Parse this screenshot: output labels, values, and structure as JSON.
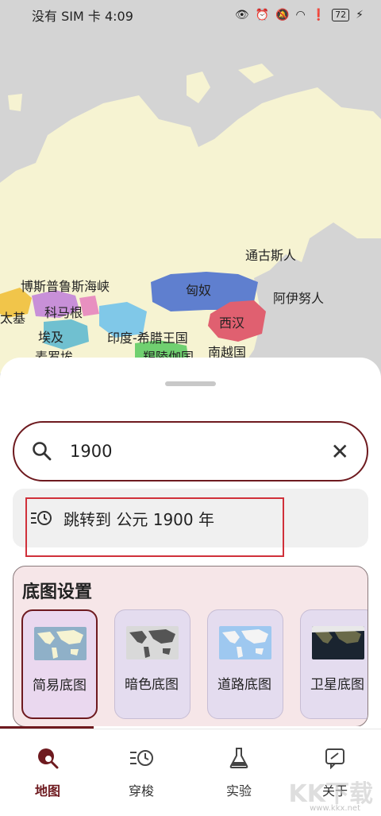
{
  "status_bar": {
    "carrier_time": "没有 SIM 卡 4:09",
    "battery": "72"
  },
  "map": {
    "labels": [
      "通古斯人",
      "博斯普鲁斯海峡",
      "匈奴",
      "阿伊努人",
      "科马根",
      "太基",
      "西汉",
      "埃及",
      "印度-希腊王国",
      "南越国",
      "麦罗埃",
      "羯陵伽国"
    ]
  },
  "search": {
    "query": "1900"
  },
  "jump": {
    "text": "跳转到 公元 1900 年"
  },
  "basemap": {
    "title": "底图设置",
    "options": [
      {
        "label": "简易底图",
        "selected": true
      },
      {
        "label": "暗色底图",
        "selected": false
      },
      {
        "label": "道路底图",
        "selected": false
      },
      {
        "label": "卫星底图",
        "selected": false
      }
    ]
  },
  "nav": {
    "items": [
      {
        "label": "地图",
        "icon": "map-search-icon",
        "active": true
      },
      {
        "label": "穿梭",
        "icon": "time-travel-icon",
        "active": false
      },
      {
        "label": "实验",
        "icon": "flask-icon",
        "active": false
      },
      {
        "label": "关于",
        "icon": "about-icon",
        "active": false
      }
    ]
  },
  "watermark": {
    "text": "KK下载",
    "url": "www.kkx.net"
  },
  "colors": {
    "accent": "#6e1a1f",
    "highlight": "#d0303a",
    "land": "#f6f3d2",
    "xiongnu": "#5f7fcf",
    "xihan": "#e06070"
  }
}
